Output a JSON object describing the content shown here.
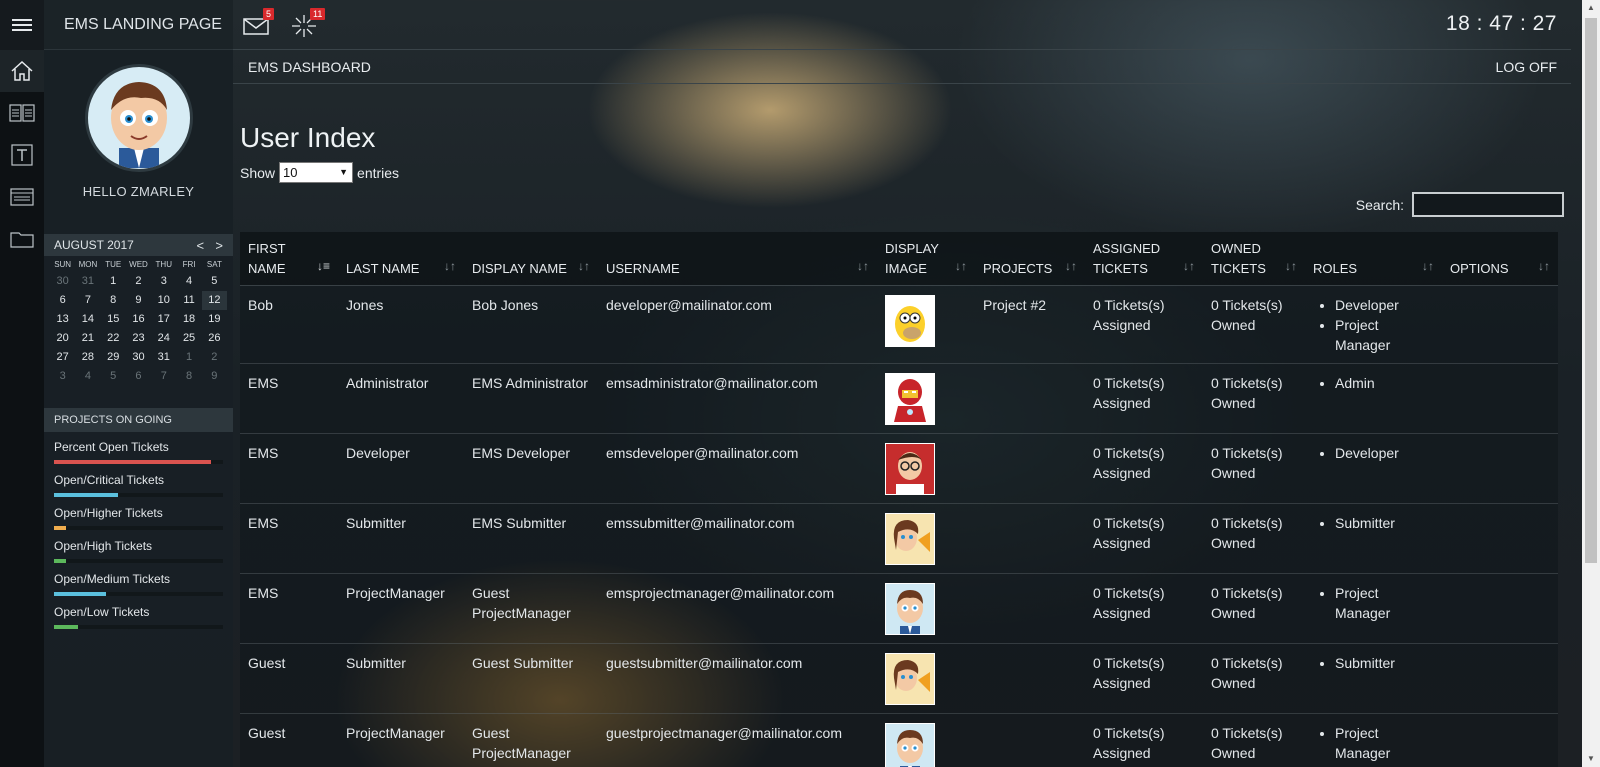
{
  "app": {
    "brand": "EMS LANDING PAGE",
    "section": "EMS DASHBOARD",
    "logoff": "LOG OFF"
  },
  "topbar": {
    "mail_badge": "5",
    "tickets_badge": "11",
    "clock": "18 : 47 : 27"
  },
  "profile": {
    "hello": "HELLO ZMARLEY"
  },
  "calendar": {
    "month": "AUGUST 2017",
    "prev": "<",
    "next": ">",
    "day_names": [
      "SUN",
      "MON",
      "TUE",
      "WED",
      "THU",
      "FRI",
      "SAT"
    ],
    "weeks": [
      [
        "30",
        "31",
        "1",
        "2",
        "3",
        "4",
        "5"
      ],
      [
        "6",
        "7",
        "8",
        "9",
        "10",
        "11",
        "12"
      ],
      [
        "13",
        "14",
        "15",
        "16",
        "17",
        "18",
        "19"
      ],
      [
        "20",
        "21",
        "22",
        "23",
        "24",
        "25",
        "26"
      ],
      [
        "27",
        "28",
        "29",
        "30",
        "31",
        "1",
        "2"
      ],
      [
        "3",
        "4",
        "5",
        "6",
        "7",
        "8",
        "9"
      ]
    ]
  },
  "projects": {
    "title": "PROJECTS ON GOING",
    "items": [
      {
        "label": "Percent Open Tickets",
        "percent": 93,
        "color": "#d9534f"
      },
      {
        "label": "Open/Critical Tickets",
        "percent": 38,
        "color": "#5bc0de"
      },
      {
        "label": "Open/Higher Tickets",
        "percent": 7,
        "color": "#f0ad4e"
      },
      {
        "label": "Open/High Tickets",
        "percent": 7,
        "color": "#5cb85c"
      },
      {
        "label": "Open/Medium Tickets",
        "percent": 31,
        "color": "#5bc0de"
      },
      {
        "label": "Open/Low Tickets",
        "percent": 14,
        "color": "#5cb85c"
      }
    ]
  },
  "page": {
    "title": "User Index",
    "show": "Show",
    "entries_value": "10",
    "entries": "entries",
    "search_label": "Search:"
  },
  "table": {
    "headers": [
      {
        "l1": "FIRST",
        "l2": "NAME"
      },
      {
        "l1": "",
        "l2": "LAST NAME"
      },
      {
        "l1": "",
        "l2": "DISPLAY NAME"
      },
      {
        "l1": "",
        "l2": "USERNAME"
      },
      {
        "l1": "DISPLAY",
        "l2": "IMAGE"
      },
      {
        "l1": "",
        "l2": "PROJECTS"
      },
      {
        "l1": "ASSIGNED",
        "l2": "TICKETS"
      },
      {
        "l1": "OWNED",
        "l2": "TICKETS"
      },
      {
        "l1": "",
        "l2": "ROLES"
      },
      {
        "l1": "",
        "l2": "OPTIONS"
      }
    ],
    "rows": [
      {
        "first": "Bob",
        "last": "Jones",
        "display": "Bob Jones",
        "username": "developer@mailinator.com",
        "image": "homer",
        "projects": "Project #2",
        "assigned1": "0 Tickets(s)",
        "assigned2": "Assigned",
        "owned1": "0 Tickets(s)",
        "owned2": "Owned",
        "roles": [
          "Developer",
          "Project Manager"
        ]
      },
      {
        "first": "EMS",
        "last": "Administrator",
        "display": "EMS Administrator",
        "username": "emsadministrator@mailinator.com",
        "image": "ironman",
        "projects": "",
        "assigned1": "0 Tickets(s)",
        "assigned2": "Assigned",
        "owned1": "0 Tickets(s)",
        "owned2": "Owned",
        "roles": [
          "Admin"
        ]
      },
      {
        "first": "EMS",
        "last": "Developer",
        "display": "EMS Developer",
        "username": "emsdeveloper@mailinator.com",
        "image": "developer",
        "projects": "",
        "assigned1": "0 Tickets(s)",
        "assigned2": "Assigned",
        "owned1": "0 Tickets(s)",
        "owned2": "Owned",
        "roles": [
          "Developer"
        ]
      },
      {
        "first": "EMS",
        "last": "Submitter",
        "display": "EMS Submitter",
        "username": "emssubmitter@mailinator.com",
        "image": "submitter",
        "projects": "",
        "assigned1": "0 Tickets(s)",
        "assigned2": "Assigned",
        "owned1": "0 Tickets(s)",
        "owned2": "Owned",
        "roles": [
          "Submitter"
        ]
      },
      {
        "first": "EMS",
        "last": "ProjectManager",
        "display": "Guest ProjectManager",
        "username": "emsprojectmanager@mailinator.com",
        "image": "manager",
        "projects": "",
        "assigned1": "0 Tickets(s)",
        "assigned2": "Assigned",
        "owned1": "0 Tickets(s)",
        "owned2": "Owned",
        "roles": [
          "Project Manager"
        ]
      },
      {
        "first": "Guest",
        "last": "Submitter",
        "display": "Guest Submitter",
        "username": "guestsubmitter@mailinator.com",
        "image": "submitter",
        "projects": "",
        "assigned1": "0 Tickets(s)",
        "assigned2": "Assigned",
        "owned1": "0 Tickets(s)",
        "owned2": "Owned",
        "roles": [
          "Submitter"
        ]
      },
      {
        "first": "Guest",
        "last": "ProjectManager",
        "display": "Guest ProjectManager",
        "username": "guestprojectmanager@mailinator.com",
        "image": "manager",
        "projects": "",
        "assigned1": "0 Tickets(s)",
        "assigned2": "Assigned",
        "owned1": "0 Tickets(s)",
        "owned2": "Owned",
        "roles": [
          "Project Manager"
        ]
      }
    ]
  }
}
